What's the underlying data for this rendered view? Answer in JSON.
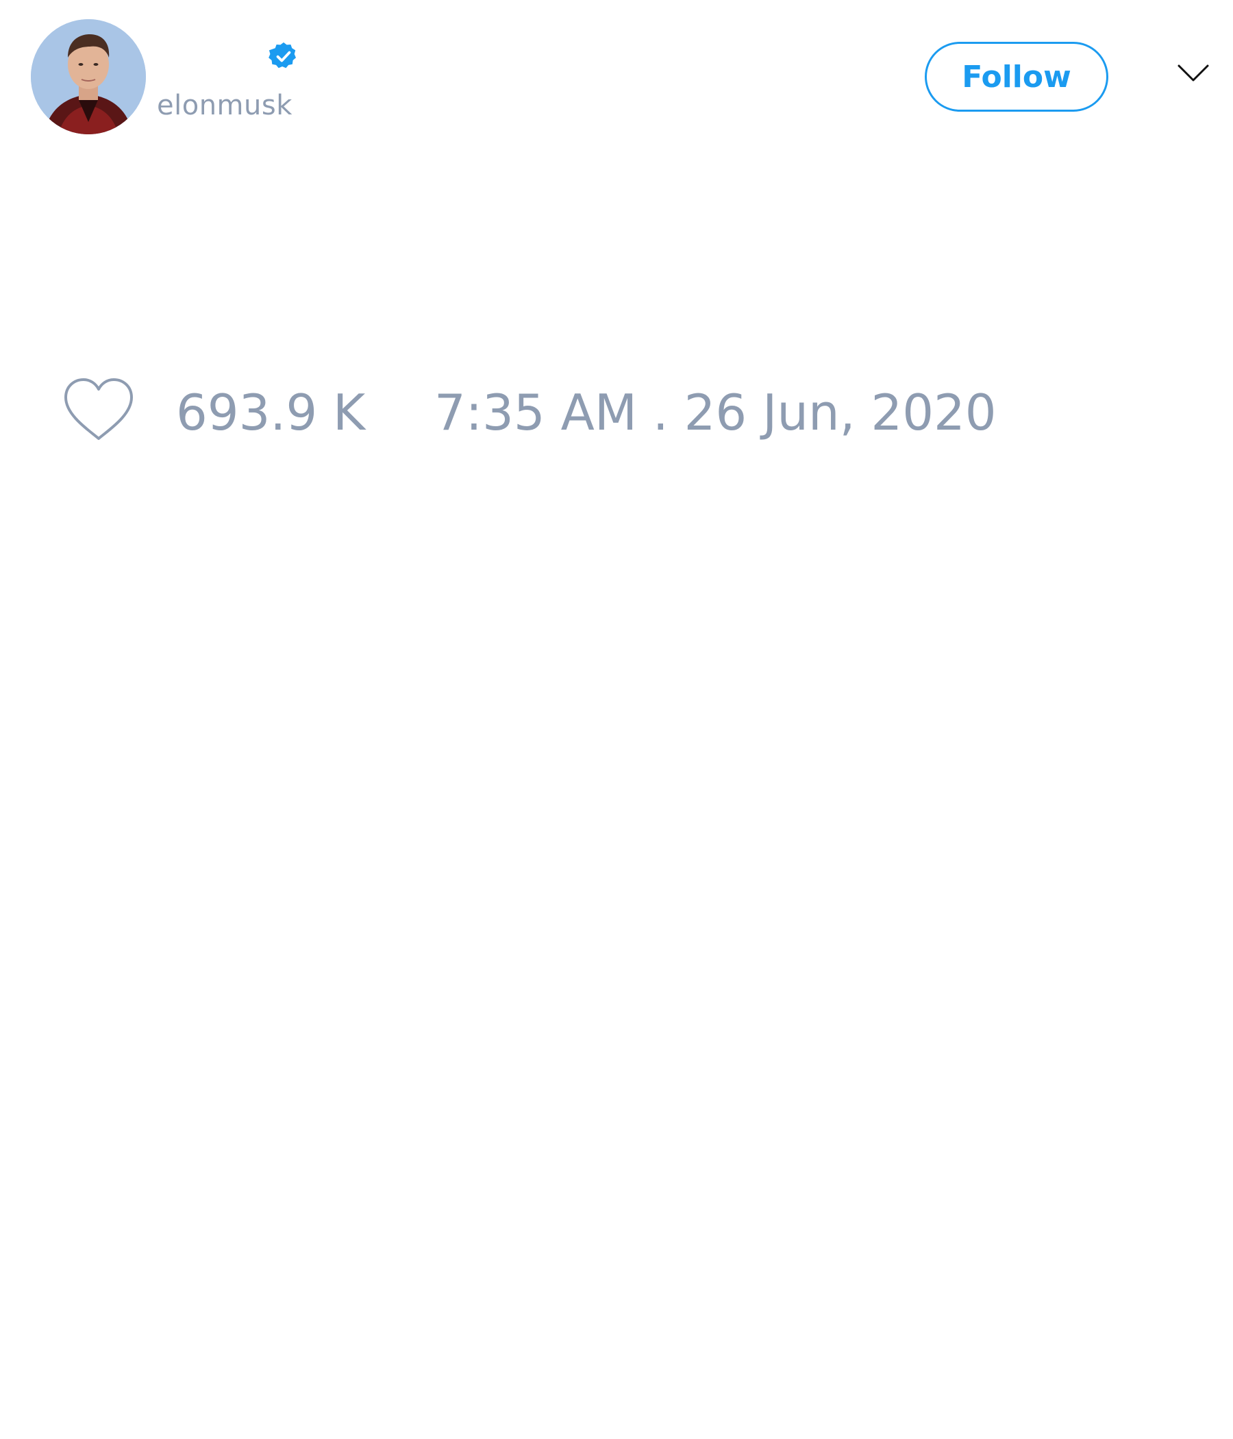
{
  "tweet": {
    "author": {
      "handle": "elonmusk",
      "verified": true,
      "avatar_icon": "profile-photo"
    },
    "follow_label": "Follow",
    "menu_icon": "chevron-down-icon",
    "likes": "693.9 K",
    "timestamp": "7:35 AM . 26 Jun, 2020"
  },
  "colors": {
    "accent": "#1b9bf0",
    "muted_text": "#8e9cb1",
    "background": "#ffffff"
  }
}
